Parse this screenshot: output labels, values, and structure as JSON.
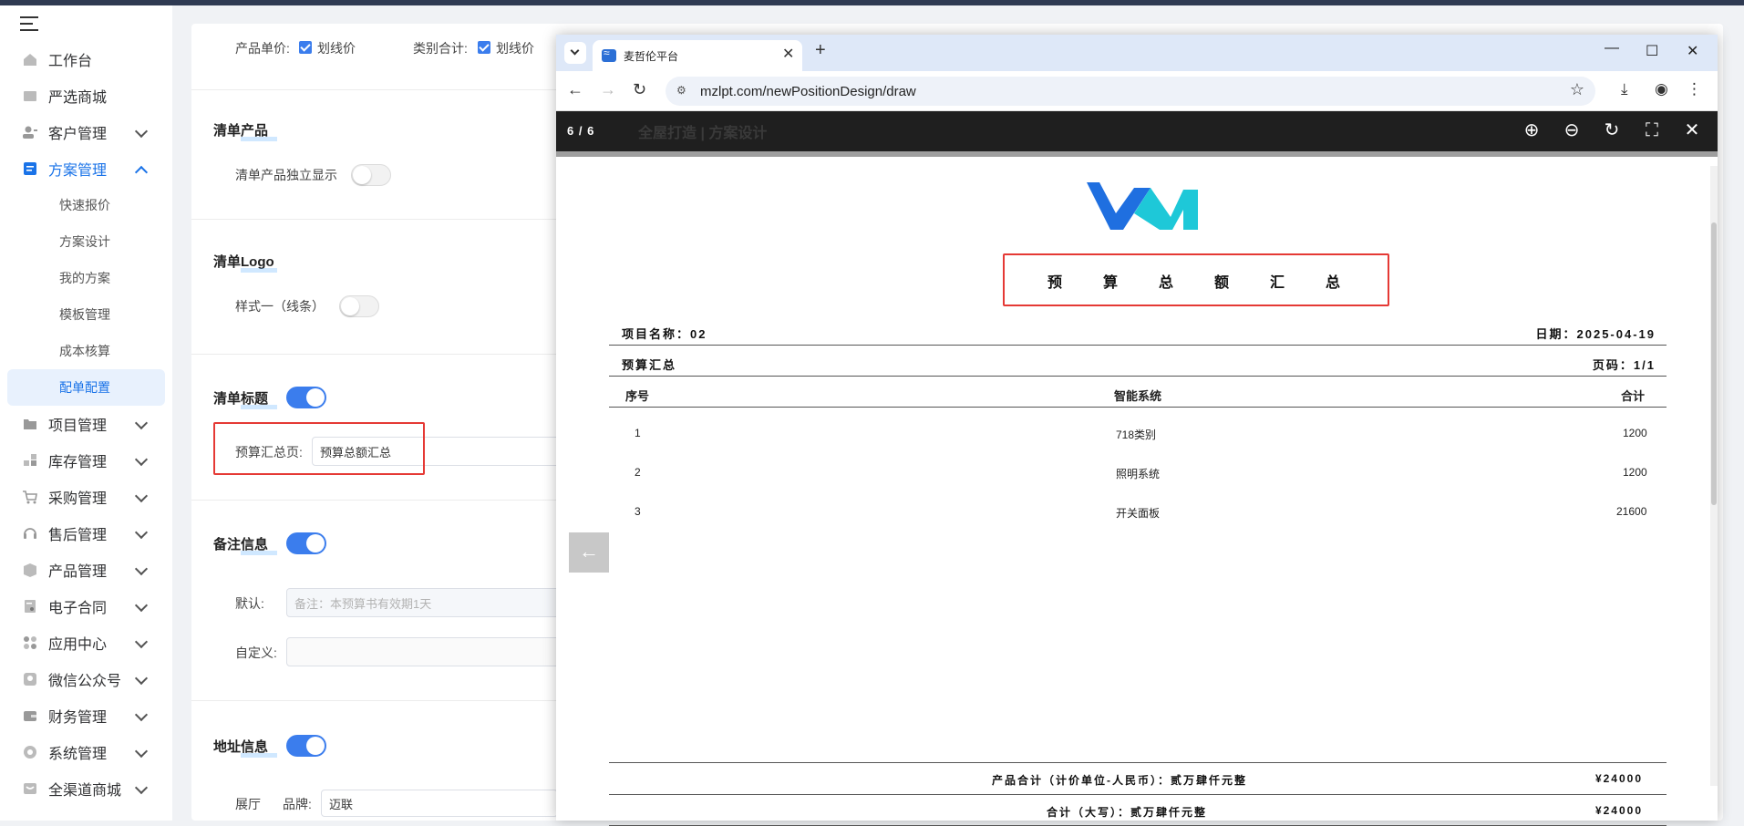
{
  "sidebar": {
    "items": [
      {
        "label": "工作台"
      },
      {
        "label": "严选商城"
      },
      {
        "label": "客户管理"
      },
      {
        "label": "方案管理"
      },
      {
        "label": "项目管理"
      },
      {
        "label": "库存管理"
      },
      {
        "label": "采购管理"
      },
      {
        "label": "售后管理"
      },
      {
        "label": "产品管理"
      },
      {
        "label": "电子合同"
      },
      {
        "label": "应用中心"
      },
      {
        "label": "微信公众号"
      },
      {
        "label": "财务管理"
      },
      {
        "label": "系统管理"
      },
      {
        "label": "全渠道商城"
      }
    ],
    "sub_items": [
      {
        "label": "快速报价"
      },
      {
        "label": "方案设计"
      },
      {
        "label": "我的方案"
      },
      {
        "label": "模板管理"
      },
      {
        "label": "成本核算"
      },
      {
        "label": "配单配置"
      }
    ]
  },
  "settings": {
    "unit_price_label": "产品单价:",
    "strike_label": "划线价",
    "category_total_label": "类别合计:",
    "strike_label_2": "划线价",
    "list_product_title": "清单产品",
    "list_product_independent": "清单产品独立显示",
    "list_logo_title": "清单Logo",
    "logo_style": "样式一（线条）",
    "list_title_title": "清单标题",
    "budget_summary_label": "预算汇总页:",
    "budget_summary_value": "预算总额汇总",
    "remark_title": "备注信息",
    "remark_default_label": "默认:",
    "remark_default_placeholder": "备注：本预算书有效期1天",
    "remark_custom_label": "自定义:",
    "address_title": "地址信息",
    "showroom_label": "展厅",
    "brand_label": "品牌:",
    "brand_value": "迈联"
  },
  "browser": {
    "tab_title": "麦哲伦平台",
    "url": "mzlpt.com/newPositionDesign/draw"
  },
  "viewer": {
    "page_count": "6 / 6",
    "ghost_title": "全屋打造 | 方案设计"
  },
  "doc": {
    "title": "预算总额汇总",
    "project_name": "项目名称：02",
    "date": "日期：2025-04-19",
    "section": "预算汇总",
    "page": "页码：1/1",
    "columns": [
      "序号",
      "智能系统",
      "合计"
    ],
    "rows": [
      [
        "1",
        "718类别",
        "1200"
      ],
      [
        "2",
        "照明系统",
        "1200"
      ],
      [
        "3",
        "开关面板",
        "21600"
      ]
    ],
    "product_total_label": "产品合计（计价单位-人民币）：贰万肆仟元整",
    "product_total_value": "¥24000",
    "grand_total_label": "合计（大写）：贰万肆仟元整",
    "grand_total_value": "¥24000",
    "remark": "备注：本预算书有效期1天"
  },
  "colors": {
    "accent": "#1a73e8",
    "highlight": "#e53935",
    "logo_blue": "#1f6fe0",
    "logo_cyan": "#1ec8d8"
  }
}
